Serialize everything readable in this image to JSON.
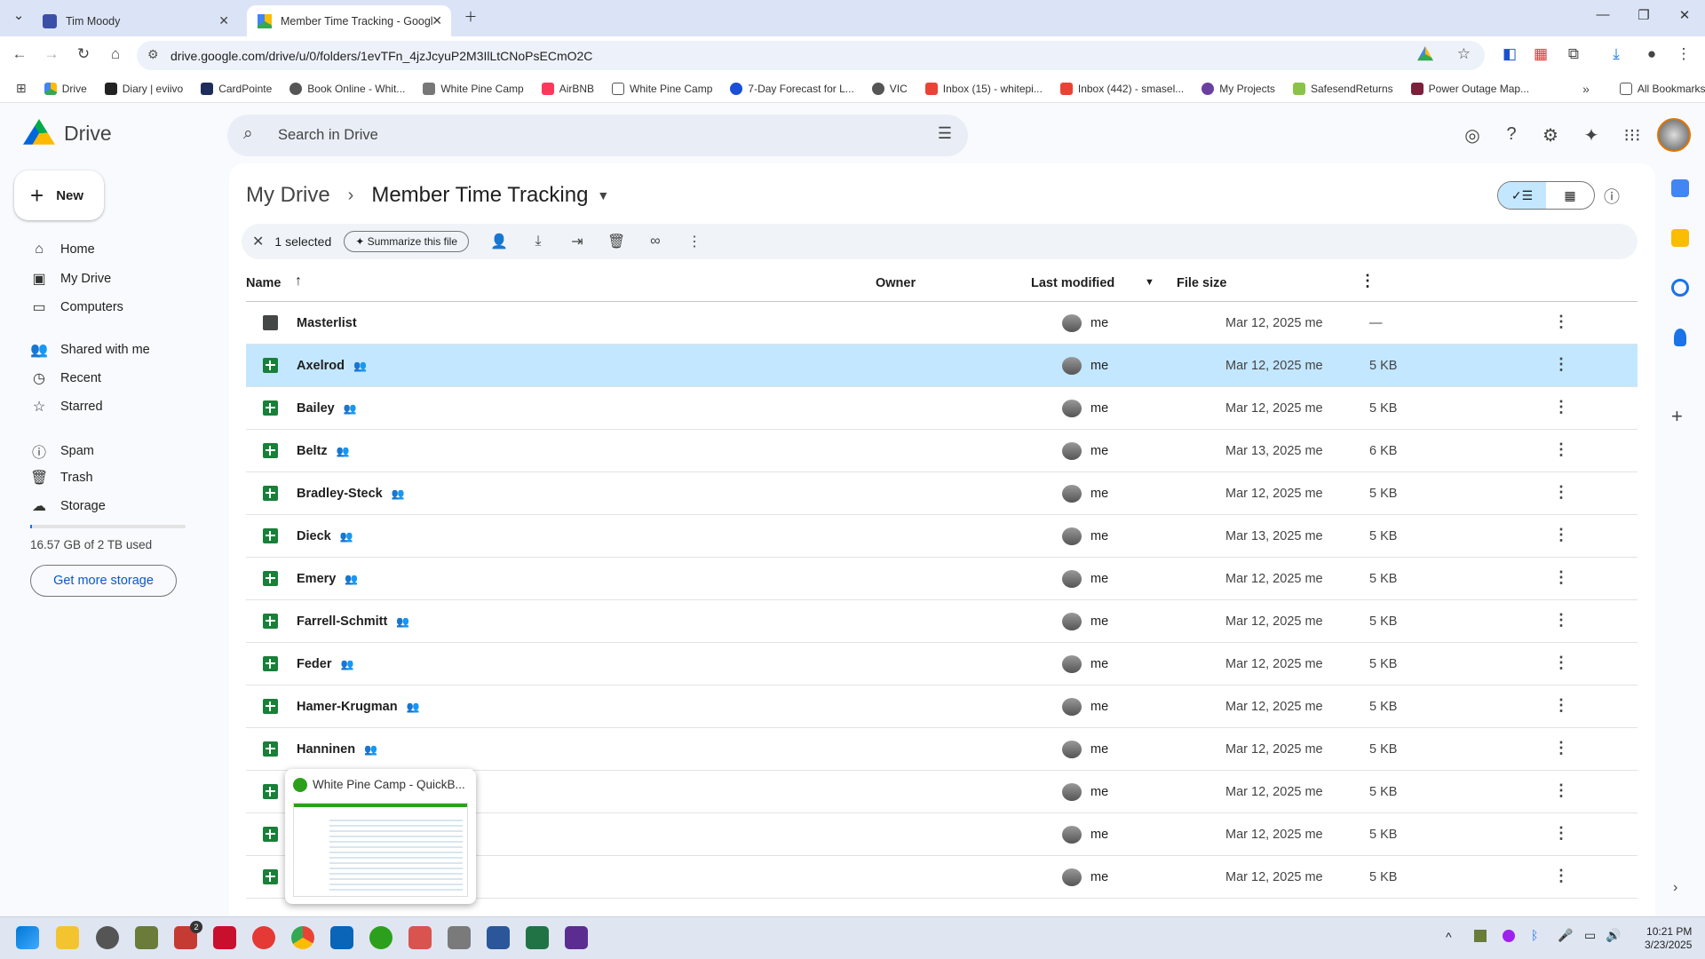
{
  "browser": {
    "tabs": [
      {
        "title": "Tim Moody"
      },
      {
        "title": "Member Time Tracking - Googl"
      }
    ],
    "url": "drive.google.com/drive/u/0/folders/1evTFn_4jzJcyuP2M3IlLtCNoPsECmO2C",
    "bookmarks": [
      "Drive",
      "Diary | eviivo",
      "CardPointe",
      "Book Online - Whit...",
      "White Pine Camp",
      "AirBNB",
      "White Pine Camp",
      "7-Day Forecast for L...",
      "VIC",
      "Inbox (15) - whitepi...",
      "Inbox (442) - smasel...",
      "My Projects",
      "SafesendReturns",
      "Power Outage Map..."
    ],
    "all_bookmarks": "All Bookmarks"
  },
  "drive": {
    "app_name": "Drive",
    "search_placeholder": "Search in Drive",
    "new_label": "New",
    "nav": [
      "Home",
      "My Drive",
      "Computers",
      "Shared with me",
      "Recent",
      "Starred",
      "Spam",
      "Trash",
      "Storage"
    ],
    "storage_used": "16.57 GB of 2 TB used",
    "get_more_storage": "Get more storage",
    "breadcrumb_root": "My Drive",
    "breadcrumb_current": "Member Time Tracking",
    "selection": {
      "count_label": "1 selected",
      "summarize_label": "Summarize this file"
    },
    "columns": {
      "name": "Name",
      "owner": "Owner",
      "modified": "Last modified",
      "size": "File size"
    },
    "rows": [
      {
        "name": "Masterlist",
        "owner": "me",
        "modified": "Mar 12, 2025 me",
        "size": "—",
        "type": "folder"
      },
      {
        "name": "Axelrod",
        "owner": "me",
        "modified": "Mar 12, 2025 me",
        "size": "5 KB",
        "type": "sheet",
        "selected": true
      },
      {
        "name": "Bailey",
        "owner": "me",
        "modified": "Mar 12, 2025 me",
        "size": "5 KB",
        "type": "sheet"
      },
      {
        "name": "Beltz",
        "owner": "me",
        "modified": "Mar 13, 2025 me",
        "size": "6 KB",
        "type": "sheet"
      },
      {
        "name": "Bradley-Steck",
        "owner": "me",
        "modified": "Mar 12, 2025 me",
        "size": "5 KB",
        "type": "sheet"
      },
      {
        "name": "Dieck",
        "owner": "me",
        "modified": "Mar 13, 2025 me",
        "size": "5 KB",
        "type": "sheet"
      },
      {
        "name": "Emery",
        "owner": "me",
        "modified": "Mar 12, 2025 me",
        "size": "5 KB",
        "type": "sheet"
      },
      {
        "name": "Farrell-Schmitt",
        "owner": "me",
        "modified": "Mar 12, 2025 me",
        "size": "5 KB",
        "type": "sheet"
      },
      {
        "name": "Feder",
        "owner": "me",
        "modified": "Mar 12, 2025 me",
        "size": "5 KB",
        "type": "sheet"
      },
      {
        "name": "Hamer-Krugman",
        "owner": "me",
        "modified": "Mar 12, 2025 me",
        "size": "5 KB",
        "type": "sheet"
      },
      {
        "name": "Hanninen",
        "owner": "me",
        "modified": "Mar 12, 2025 me",
        "size": "5 KB",
        "type": "sheet"
      },
      {
        "name": "",
        "owner": "me",
        "modified": "Mar 12, 2025 me",
        "size": "5 KB",
        "type": "sheet"
      },
      {
        "name": "",
        "owner": "me",
        "modified": "Mar 12, 2025 me",
        "size": "5 KB",
        "type": "sheet"
      },
      {
        "name": "",
        "owner": "me",
        "modified": "Mar 12, 2025 me",
        "size": "5 KB",
        "type": "sheet"
      }
    ]
  },
  "preview": {
    "title": "White Pine Camp  - QuickB..."
  },
  "taskbar": {
    "time": "10:21 PM",
    "date": "3/23/2025",
    "badge": "2"
  },
  "colors": {
    "selected_row": "#c2e7ff",
    "sheet_green": "#188038",
    "accent": "#0b57d0"
  }
}
